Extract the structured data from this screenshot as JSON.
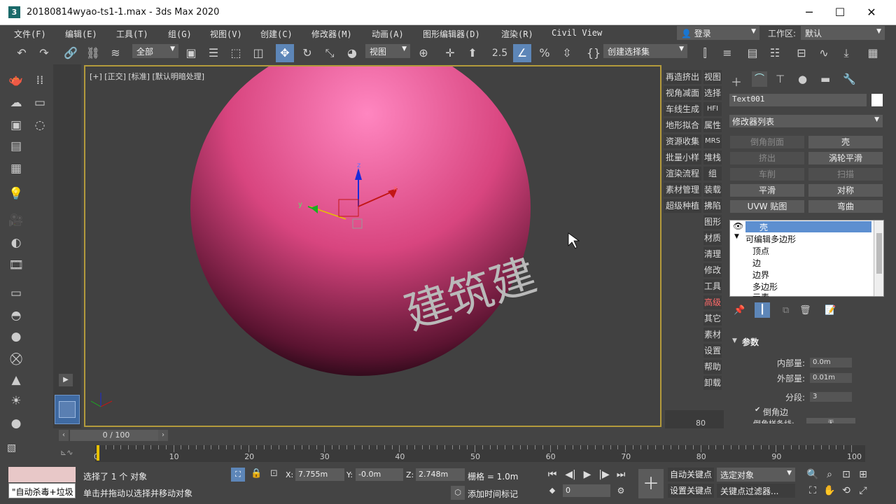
{
  "window": {
    "title": "20180814wyao-ts1-1.max - 3ds Max 2020",
    "app_icon": "3",
    "minimize": "─",
    "maximize": "☐",
    "close": "✕"
  },
  "menu": [
    "文件(F)",
    "编辑(E)",
    "工具(T)",
    "组(G)",
    "视图(V)",
    "创建(C)",
    "修改器(M)",
    "动画(A)",
    "图形编辑器(D)",
    "渲染(R)",
    "Civil View"
  ],
  "user": {
    "label": "登录"
  },
  "workspace": {
    "label": "工作区:",
    "value": "默认"
  },
  "toolbar": {
    "filter_value": "全部",
    "refcoord_value": "视图",
    "selection_set_placeholder": "创建选择集",
    "snap_value": "2.5",
    "percent": "%"
  },
  "viewport": {
    "label": "[+] [正交] [标准] [默认明暗处理]",
    "text_on_sphere": "建筑建",
    "sphere_color": "#d8457f",
    "axis_x": "x",
    "axis_y": "y",
    "axis_z": "z"
  },
  "cmd_col1": [
    "再造挤出",
    "视角减面",
    "车线生成",
    "地形拟合",
    "资源收集",
    "批量小样",
    "渲染流程",
    "素材管理",
    "超级种植"
  ],
  "cmd_col2": [
    "视图",
    "选择",
    "HFI",
    "属性",
    "MRS",
    "堆栈",
    "组",
    "装载",
    "拂陷",
    "图形",
    "材质",
    "清理",
    "修改",
    "工具",
    "高级",
    "其它",
    "素材",
    "设置",
    "帮助",
    "卸载"
  ],
  "cmd_col2_highlight": "高级",
  "right_panel": {
    "object_name": "Text001",
    "modifier_list": "修改器列表",
    "modifier_buttons": [
      {
        "label": "倒角剖面",
        "enabled": false
      },
      {
        "label": "壳",
        "enabled": true
      },
      {
        "label": "挤出",
        "enabled": false
      },
      {
        "label": "涡轮平滑",
        "enabled": true
      },
      {
        "label": "车削",
        "enabled": false
      },
      {
        "label": "扫描",
        "enabled": false
      },
      {
        "label": "平滑",
        "enabled": true
      },
      {
        "label": "对称",
        "enabled": true
      },
      {
        "label": "UVW 贴图",
        "enabled": true
      },
      {
        "label": "弯曲",
        "enabled": true
      }
    ],
    "stack": [
      "壳",
      "可编辑多边形",
      "顶点",
      "边",
      "边界",
      "多边形",
      "元素"
    ],
    "rollout_title": "参数",
    "params": [
      {
        "label": "内部量:",
        "value": "0.0m"
      },
      {
        "label": "外部量:",
        "value": "0.01m"
      },
      {
        "label": "分段:",
        "value": "3"
      }
    ],
    "checkbox_label": "倒角边",
    "cut_label": "倒角样条线:",
    "cut_value": "无"
  },
  "timeline": {
    "slider_text": "0 / 100",
    "ticks": [
      "0",
      "10",
      "20",
      "30",
      "40",
      "50",
      "60",
      "70",
      "80",
      "90",
      "100"
    ],
    "mini_label": "80"
  },
  "status": {
    "selected": "选择了 1 个 对象",
    "prompt": "单击并拖动以选择并移动对象",
    "script_text": "\"自动杀毒+垃圾",
    "x_label": "X:",
    "x_value": "7.755m",
    "y_label": "Y:",
    "y_value": "-0.0m",
    "z_label": "Z:",
    "z_value": "2.748m",
    "grid": "栅格 = 1.0m",
    "add_time_tag": "添加时间标记",
    "autokey": "自动关键点",
    "setkey": "设置关键点",
    "selected_obj": "选定对象",
    "key_filter": "关键点过滤器...",
    "frame_value": "0"
  }
}
